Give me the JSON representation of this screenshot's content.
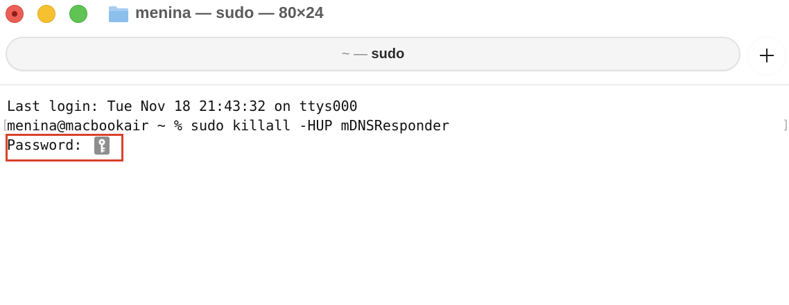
{
  "window": {
    "title": "menina — sudo — 80×24"
  },
  "tab": {
    "prefix": "~ —",
    "name": "sudo"
  },
  "icons": {
    "folder": "folder-icon",
    "key": "key-icon",
    "plus": "plus-icon"
  },
  "terminal": {
    "lines": [
      "Last login: Tue Nov 18 21:43:32 on ttys000",
      "menina@macbookair ~ % sudo killall -HUP mDNSResponder",
      "Password:"
    ],
    "marks": {
      "left": "[",
      "right": "]"
    }
  },
  "colors": {
    "close": "#ec5f57",
    "minimize": "#f5c130",
    "maximize": "#5fc453",
    "highlight": "#d9412a",
    "key_icon": "#8e8e8e"
  }
}
